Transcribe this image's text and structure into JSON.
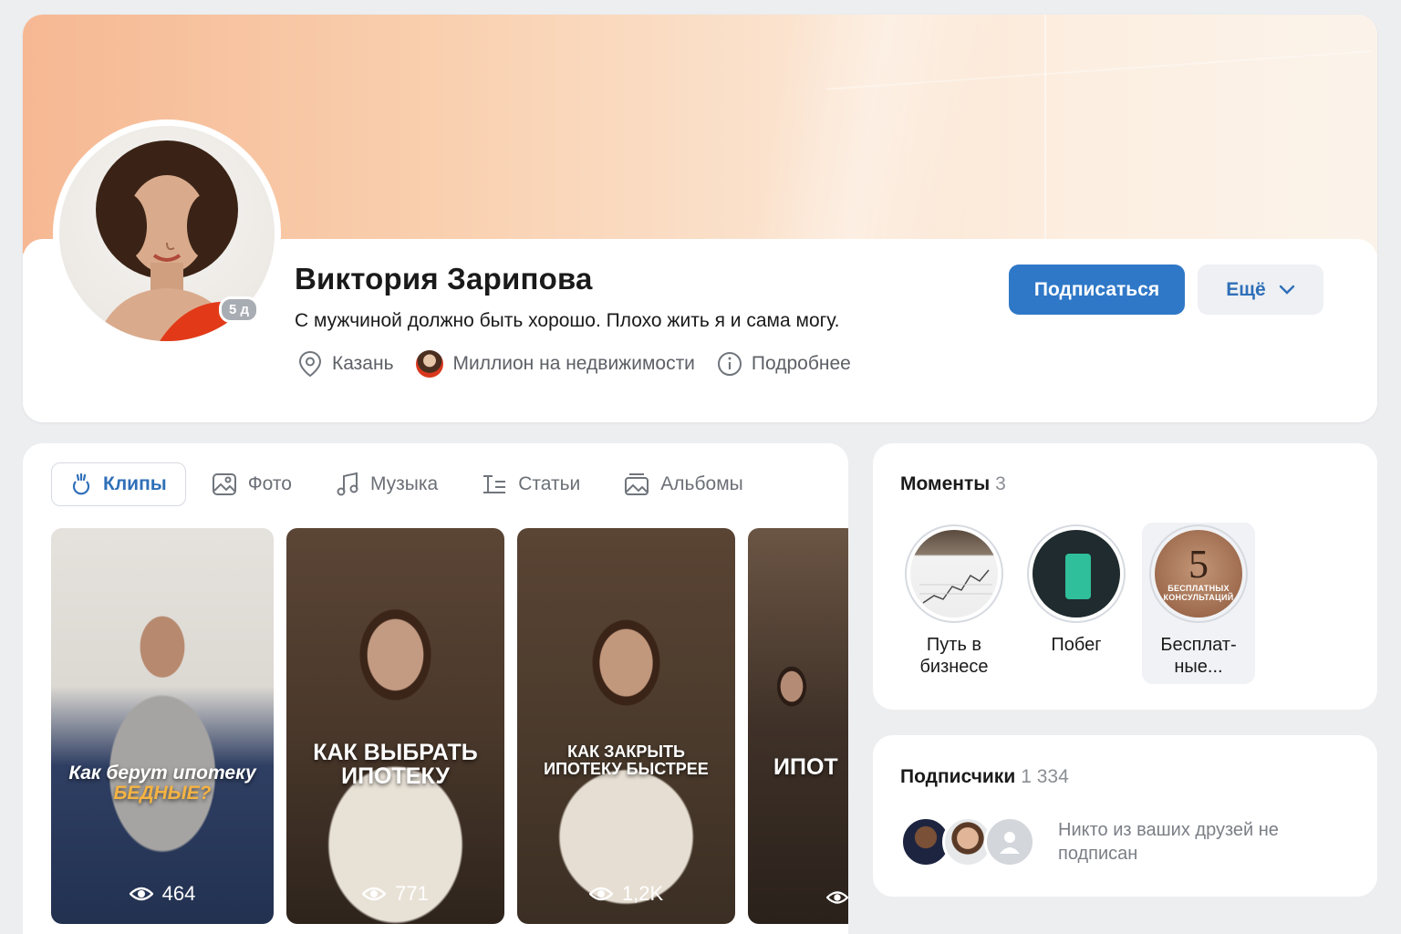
{
  "profile": {
    "name": "Виктория Зарипова",
    "status": "С мужчиной должно быть хорошо. Плохо жить я и сама могу.",
    "avatar_badge": "5 д",
    "city": "Казань",
    "community": "Миллион на недвижимости",
    "details": "Подробнее",
    "subscribe_label": "Подписаться",
    "more_label": "Ещё"
  },
  "tabs": [
    {
      "label": "Клипы",
      "icon": "clip-icon",
      "active": true
    },
    {
      "label": "Фото",
      "icon": "photo-icon",
      "active": false
    },
    {
      "label": "Музыка",
      "icon": "music-icon",
      "active": false
    },
    {
      "label": "Статьи",
      "icon": "article-icon",
      "active": false
    },
    {
      "label": "Альбомы",
      "icon": "album-icon",
      "active": false
    }
  ],
  "clips": [
    {
      "caption_line1": "Как берут ипотеку",
      "caption_line2": "БЕДНЫЕ?",
      "views": "464"
    },
    {
      "caption_line1": "КАК ВЫБРАТЬ",
      "caption_line2": "ИПОТЕКУ",
      "views": "771"
    },
    {
      "caption_line1": "КАК ЗАКРЫТЬ",
      "caption_line2": "ИПОТЕКУ БЫСТРЕЕ",
      "views": "1,2K"
    },
    {
      "caption_line1": "ИПОТ",
      "caption_line2": "",
      "views": ""
    }
  ],
  "moments": {
    "title": "Моменты",
    "count": "3",
    "items": [
      {
        "label": "Путь в бизнесе"
      },
      {
        "label": "Побег"
      },
      {
        "label": "Бесплат-ные...",
        "badge_number": "5",
        "badge_text": "БЕСПЛАТНЫХ КОНСУЛЬТАЦИЙ"
      }
    ]
  },
  "subscribers": {
    "title": "Подписчики",
    "count": "1 334",
    "note": "Никто из ваших друзей не подписан"
  },
  "colors": {
    "accent": "#2f78c8",
    "link": "#2f6fb8",
    "background": "#edeef0"
  }
}
